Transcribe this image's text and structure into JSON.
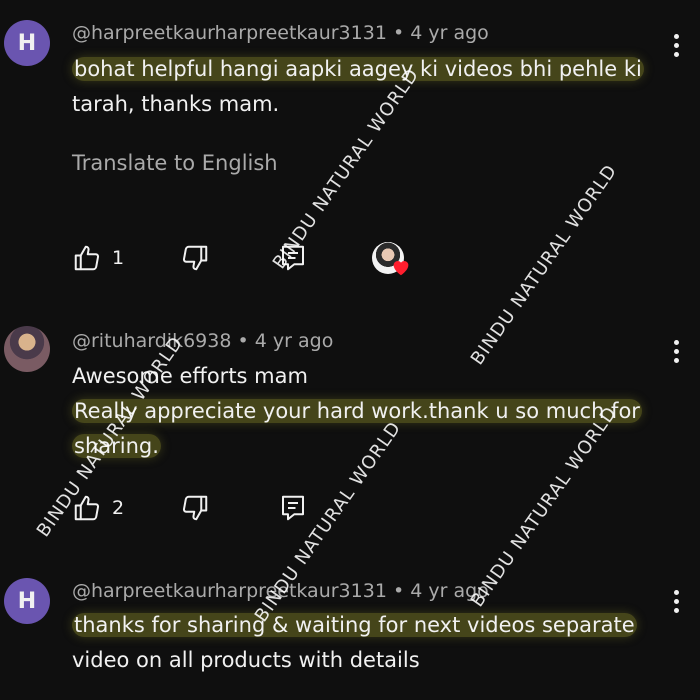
{
  "comments": [
    {
      "avatar_letter": "H",
      "avatar_color": "#6a55b0",
      "author": "@harpreetkaurharpreetkaur3131",
      "separator": "•",
      "age": "4 yr ago",
      "lines": [
        "bohat helpful hangi aapki aagey ki videos bhi pehle ki",
        "tarah, thanks mam."
      ],
      "translate": "Translate to English",
      "likes": "1",
      "creator_heart": true
    },
    {
      "avatar_letter": "",
      "author": "@rituhardik6938",
      "separator": "•",
      "age": "4 yr ago",
      "lines": [
        "Awesome efforts mam",
        "Really appreciate your hard work.thank u so much for",
        "sharing."
      ],
      "likes": "2"
    },
    {
      "avatar_letter": "H",
      "avatar_color": "#6a55b0",
      "author": "@harpreetkaurharpreetkaur3131",
      "separator": "•",
      "age": "4 yr ago",
      "lines": [
        "thanks for sharing & waiting for next videos separate",
        "video on all products with details"
      ]
    }
  ],
  "watermark": "BINDU NATURAL WORLD",
  "highlight_color": "#878728"
}
